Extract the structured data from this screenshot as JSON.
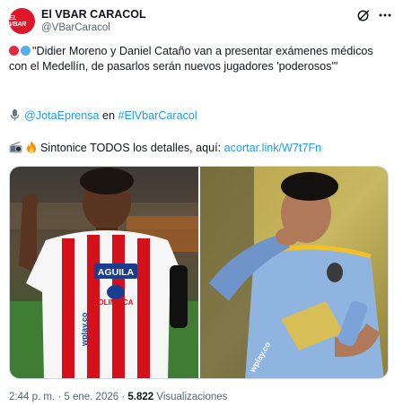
{
  "account": {
    "avatar_text": "EL VBAR",
    "display_name": "El VBAR CARACOL",
    "handle": "@VBarCaracol"
  },
  "tweet": {
    "line1": "\"Didier Moreno y Daniel Cataño van a presentar exámenes médicos con el Medellín, de pasarlos serán nuevos jugadores 'poderosos'\"",
    "mention": "@JotaEprensa",
    "connector": " en ",
    "hashtag": "#ElVbarCaracol",
    "line3_text": "Sintonice TODOS los detalles, aquí: ",
    "link": "acortar.link/W7t7Fn"
  },
  "media": {
    "left_jersey_text": "AGUILA",
    "left_jersey_text2": "OLIMPICA",
    "left_sleeve_text": "wplay.co",
    "right_sleeve_text": "wplay.co"
  },
  "meta": {
    "time": "2:44 p. m.",
    "sep": " · ",
    "date": "5 ene. 2026",
    "views_count": "5.822",
    "views_label": " Visualizaciones"
  },
  "colors": {
    "accent_link": "#1d9bf0",
    "brand_red": "#e0162b",
    "muted": "#536471"
  }
}
